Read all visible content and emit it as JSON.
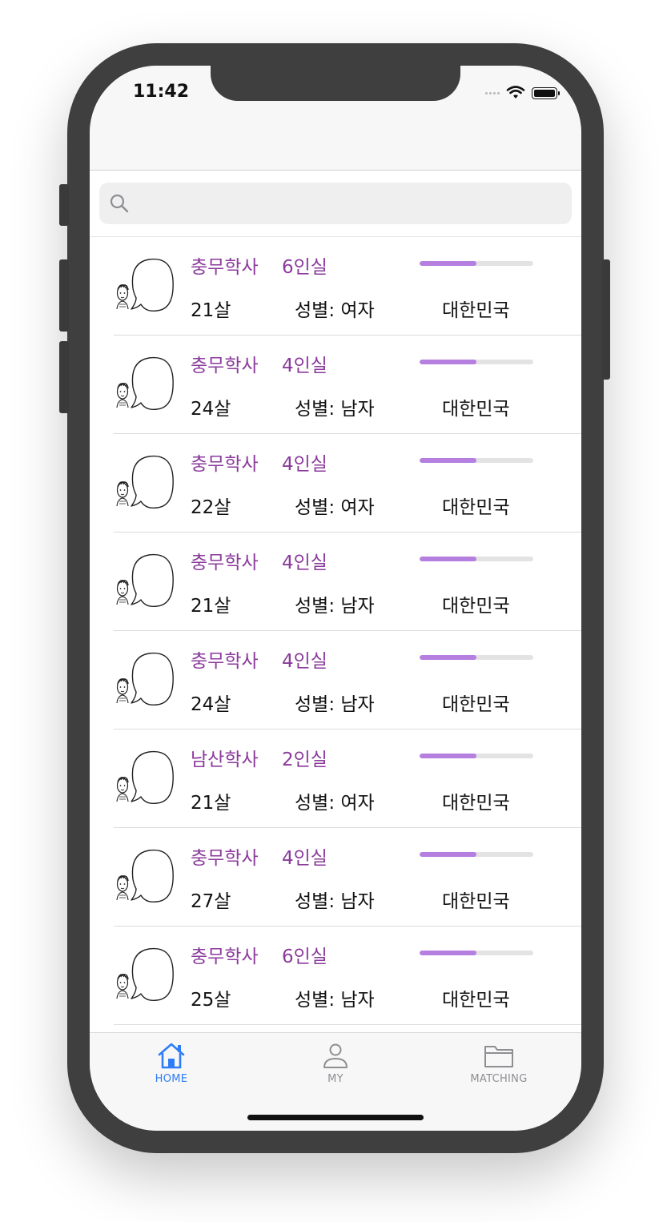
{
  "status_bar": {
    "time": "11:42"
  },
  "search": {
    "placeholder": ""
  },
  "rows": [
    {
      "dorm": "충무학사",
      "room": "6인실",
      "age": "21살",
      "gender": "성별: 여자",
      "country": "대한민국",
      "progress": 0.5
    },
    {
      "dorm": "충무학사",
      "room": "4인실",
      "age": "24살",
      "gender": "성별: 남자",
      "country": "대한민국",
      "progress": 0.5
    },
    {
      "dorm": "충무학사",
      "room": "4인실",
      "age": "22살",
      "gender": "성별: 여자",
      "country": "대한민국",
      "progress": 0.5
    },
    {
      "dorm": "충무학사",
      "room": "4인실",
      "age": "21살",
      "gender": "성별: 남자",
      "country": "대한민국",
      "progress": 0.5
    },
    {
      "dorm": "충무학사",
      "room": "4인실",
      "age": "24살",
      "gender": "성별: 남자",
      "country": "대한민국",
      "progress": 0.5
    },
    {
      "dorm": "남산학사",
      "room": "2인실",
      "age": "21살",
      "gender": "성별: 여자",
      "country": "대한민국",
      "progress": 0.5
    },
    {
      "dorm": "충무학사",
      "room": "4인실",
      "age": "27살",
      "gender": "성별: 남자",
      "country": "대한민국",
      "progress": 0.5
    },
    {
      "dorm": "충무학사",
      "room": "6인실",
      "age": "25살",
      "gender": "성별: 남자",
      "country": "대한민국",
      "progress": 0.5
    }
  ],
  "tabbar": {
    "items": [
      {
        "label": "HOME",
        "icon": "home-icon",
        "active": true
      },
      {
        "label": "MY",
        "icon": "person-icon",
        "active": false
      },
      {
        "label": "MATCHING",
        "icon": "folder-icon",
        "active": false
      }
    ]
  },
  "colors": {
    "accent_purple": "#8b3a9c",
    "progress_fill": "#b57fe0",
    "progress_track": "#e3e3e3",
    "tab_active": "#2f7df6",
    "tab_inactive": "#8e8e93"
  }
}
